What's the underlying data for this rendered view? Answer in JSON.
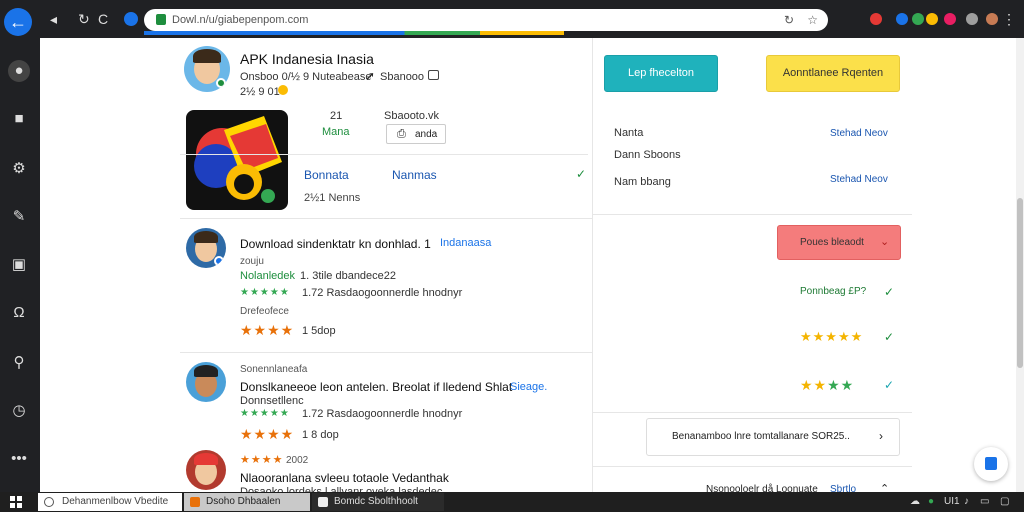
{
  "browser": {
    "url": "Dowl.n/u/giabepenpom.com"
  },
  "profile": {
    "name": "APK Indanesia Inasia",
    "meta_line": "Onsboo 0/½ 9 Nuteabease",
    "meta_extra": "Sbanooo",
    "date": "2½ 9 01"
  },
  "stats": {
    "left_value": "21",
    "left_label": "Mana",
    "right_value": "Sbaooto.vk",
    "right_button": "anda"
  },
  "app_tabs": {
    "tab1": "Bonnata",
    "tab2": "Nanmas",
    "count": "2½1 Nenns"
  },
  "reviews": [
    {
      "headline": "Download sindenktatr kn donhlad. 1",
      "headline_link": "Indanaasa",
      "handle": "zouju",
      "line1_label": "Nolanledek",
      "line1": "1. 3tile dbandece22",
      "line2": "1.72 Rasdaogoonnerdle hnodnyr",
      "footer": "Drefeofece",
      "rating_text": "1 5dop"
    },
    {
      "handle": "Sonennlaneafa",
      "headline": "Donslkaneeoe leon antelen. Breolat if lledend Shlat",
      "headline_link": "Sieage.",
      "line1": "Donnsetllenc",
      "line2": "1.72 Rasdaogoonnerdle hnodnyr",
      "rating_text": "1 8 dop"
    },
    {
      "handle": "2002",
      "headline": "Nlaooranlana svleeu totaole Vedanthak",
      "line1": "Dosaoko lordeks l allvanr oveka lasdedec"
    }
  ],
  "right_panel": {
    "button_teal": "Lep fhecelton",
    "button_yellow": "Aonntlanee Rqenten",
    "rows": [
      {
        "label": "Nanta",
        "action": "Stehad Neov"
      },
      {
        "label": "Dann Sboons",
        "action": ""
      },
      {
        "label": "Nam bbang",
        "action": "Stehad Neov"
      }
    ],
    "button_red": "Poues bleaodt",
    "check_rows": [
      "Ponnbeag £P?",
      "",
      ""
    ],
    "link_box": "Benanamboo lnre  tomtallanare SOR25..",
    "bottom_link": "Nsonooloelr då Loonuate",
    "bottom_link_blue": "Sbrtlo"
  },
  "taskbar": {
    "search_text": "Dehanmenlbow Vbedite",
    "task1": "Dsoho Dhbaalen",
    "task2": "Bomdc Sbolthhoolt",
    "tray_text": "UI1"
  }
}
